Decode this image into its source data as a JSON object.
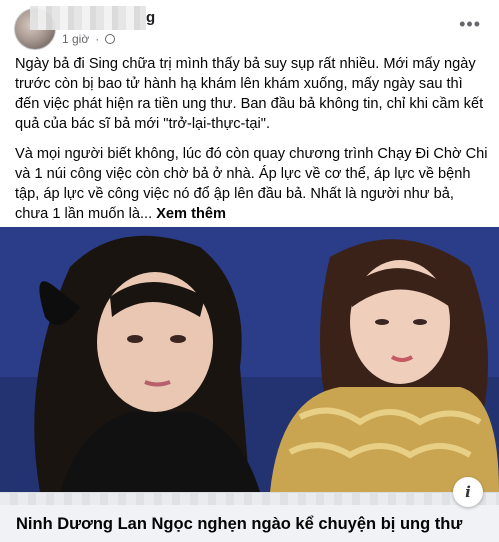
{
  "post": {
    "author_tail": "g",
    "time": "1 giờ",
    "more_icon": "•••",
    "paragraph1": "Ngày bả đi Sing chữa trị mình thấy bả suy sụp rất nhiều. Mới mấy ngày trước còn bị bao tử hành hạ khám lên khám xuống, mấy ngày sau thì đến việc phát hiện ra tiền ung thư. Ban đầu bả không tin, chỉ khi cầm kết quả của bác sĩ bả mới \"trở-lại-thực-tại\".",
    "paragraph2": "Và mọi người biết không, lúc đó còn quay chương trình Chạy Đi Chờ Chi và 1 núi công việc còn chờ bả ở nhà. Áp lực về cơ thể, áp lực về bệnh tập, áp lực về công việc nó đổ ập lên đầu bả. Nhất là người như bả, chưa 1 lần muốn là...",
    "see_more": "Xem thêm"
  },
  "link_preview": {
    "caption": "Ninh Dương Lan Ngọc nghẹn ngào kể chuyện bị ung thư",
    "info_icon": "i"
  },
  "colors": {
    "text": "#050505",
    "meta": "#65676b",
    "caption_bg": "#f0f2f5",
    "photo_bg": "#2c3d86"
  }
}
